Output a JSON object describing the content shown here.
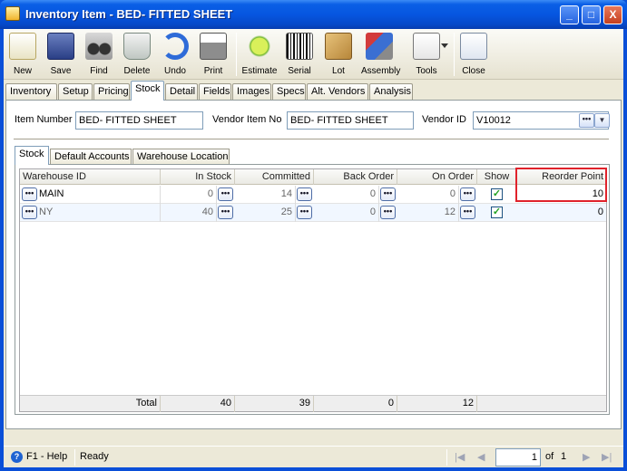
{
  "window": {
    "title": "Inventory Item - BED- FITTED SHEET",
    "minimize": "_",
    "maximize": "□",
    "close": "X"
  },
  "toolbar": {
    "new": "New",
    "save": "Save",
    "find": "Find",
    "delete": "Delete",
    "undo": "Undo",
    "print": "Print",
    "estimate": "Estimate",
    "serial": "Serial",
    "lot": "Lot",
    "assembly": "Assembly",
    "tools": "Tools",
    "close": "Close"
  },
  "tabs": [
    "Inventory",
    "Setup",
    "Pricing",
    "Stock",
    "Detail",
    "Fields",
    "Images",
    "Specs",
    "Alt. Vendors",
    "Analysis"
  ],
  "form": {
    "item_number_label": "Item Number",
    "item_number": "BED- FITTED SHEET",
    "vendor_item_no_label": "Vendor Item No",
    "vendor_item_no": "BED- FITTED SHEET",
    "vendor_id_label": "Vendor ID",
    "vendor_id": "V10012"
  },
  "subtabs": [
    "Stock",
    "Default Accounts",
    "Warehouse Location"
  ],
  "grid": {
    "headers": [
      "Warehouse ID",
      "In Stock",
      "Committed",
      "Back Order",
      "On Order",
      "Show",
      "Reorder Point"
    ],
    "rows": [
      {
        "warehouse": "MAIN",
        "in_stock": "0",
        "committed": "14",
        "back_order": "0",
        "on_order": "0",
        "show": true,
        "reorder_point": "10"
      },
      {
        "warehouse": "NY",
        "in_stock": "40",
        "committed": "25",
        "back_order": "0",
        "on_order": "12",
        "show": true,
        "reorder_point": "0"
      }
    ],
    "totals": {
      "label": "Total",
      "in_stock": "40",
      "committed": "39",
      "back_order": "0",
      "on_order": "12"
    }
  },
  "status": {
    "help": "F1 - Help",
    "state": "Ready",
    "page": "1",
    "of": "of",
    "total_pages": "1"
  },
  "colors": {
    "title_bar": "#0656e0",
    "highlight": "#e0222b",
    "check": "#21a121"
  }
}
